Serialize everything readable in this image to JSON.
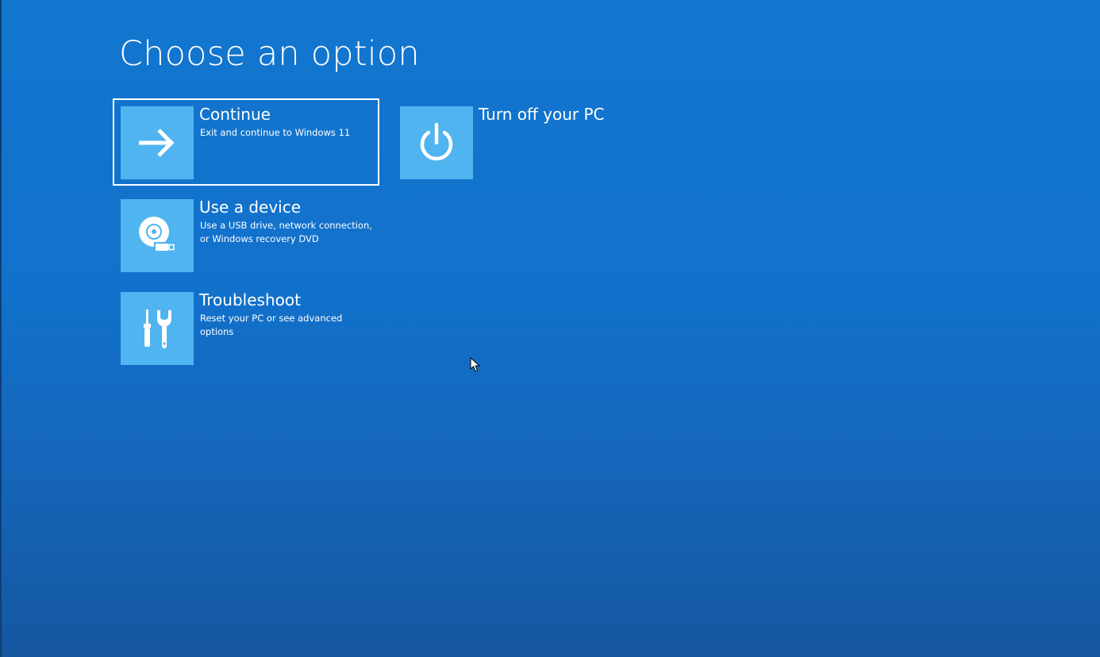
{
  "screen": {
    "title": "Choose an option",
    "background_color": "#1271cb",
    "tile_color": "#4fb4f0"
  },
  "options": [
    {
      "title": "Continue",
      "description": "Exit and continue to Windows 11",
      "icon": "arrow-right-icon",
      "selected": true
    },
    {
      "title": "Turn off your PC",
      "description": "",
      "icon": "power-icon",
      "selected": false
    },
    {
      "title": "Use a device",
      "description": "Use a USB drive, network connection,\nor Windows recovery DVD",
      "icon": "disc-usb-icon",
      "selected": false
    },
    {
      "title": "Troubleshoot",
      "description": "Reset your PC or see advanced options",
      "icon": "tools-icon",
      "selected": false
    }
  ],
  "cursor": {
    "icon": "mouse-pointer-icon"
  }
}
